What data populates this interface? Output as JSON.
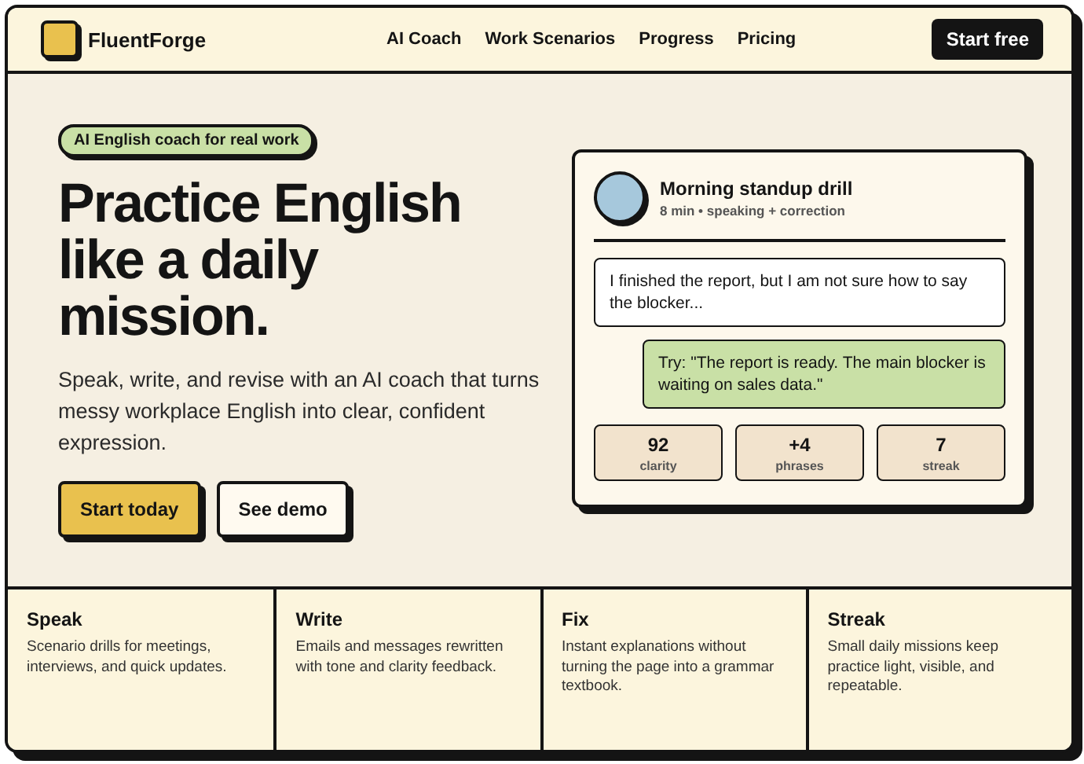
{
  "brand": {
    "name": "FluentForge"
  },
  "nav": {
    "links": [
      {
        "label": "AI Coach"
      },
      {
        "label": "Work Scenarios"
      },
      {
        "label": "Progress"
      },
      {
        "label": "Pricing"
      }
    ],
    "cta": "Start free"
  },
  "hero": {
    "badge": "AI English coach for real work",
    "headline": [
      "Practice English",
      "like a daily",
      "mission."
    ],
    "lead": "Speak, write, and revise with an AI coach that turns messy workplace English into clear, confident expression.",
    "buttons": [
      {
        "label": "Start today",
        "kind": "primary"
      },
      {
        "label": "See demo",
        "kind": "secondary"
      }
    ]
  },
  "drill": {
    "title": "Morning standup drill",
    "meta": "8 min • speaking + correction",
    "messages": [
      {
        "kind": "user",
        "text": "I finished the report, but I am not sure how to say the blocker..."
      },
      {
        "kind": "coach",
        "text": "Try: \"The report is ready. The main blocker is waiting on sales data.\""
      }
    ],
    "stats": [
      {
        "value": "92",
        "label": "clarity"
      },
      {
        "value": "+4",
        "label": "phrases"
      },
      {
        "value": "7",
        "label": "streak"
      }
    ]
  },
  "features": [
    {
      "title": "Speak",
      "text": "Scenario drills for meetings, interviews, and quick updates."
    },
    {
      "title": "Write",
      "text": "Emails and messages rewritten with tone and clarity feedback."
    },
    {
      "title": "Fix",
      "text": "Instant explanations without turning the page into a grammar textbook."
    },
    {
      "title": "Streak",
      "text": "Small daily missions keep practice light, visible, and repeatable."
    }
  ]
}
